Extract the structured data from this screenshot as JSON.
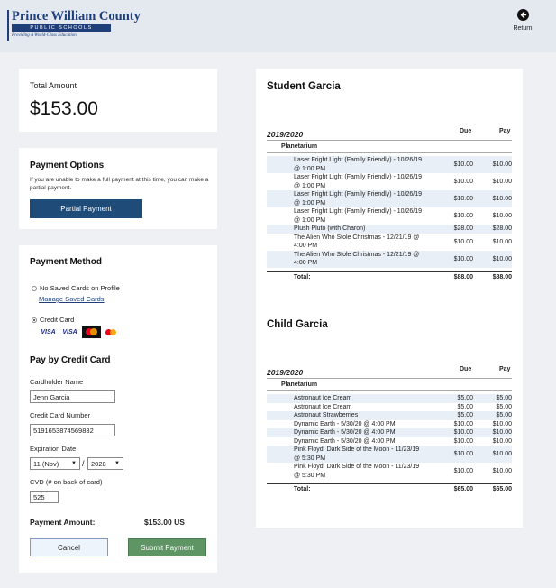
{
  "header": {
    "logo_name": "Prince William County",
    "logo_bar": "PUBLIC SCHOOLS",
    "logo_tagline": "Providing A World-Class Education",
    "return_label": "Return"
  },
  "total_amount": {
    "label": "Total Amount",
    "value": "$153.00"
  },
  "payment_options": {
    "title": "Payment Options",
    "note": "If you are unable to make a full payment at this time, you can make a partial payment.",
    "button": "Partial Payment"
  },
  "payment_method": {
    "title": "Payment Method",
    "no_saved_cards": "No Saved Cards on Profile",
    "manage_link": "Manage Saved Cards",
    "credit_card_option": "Credit Card",
    "card_brands": [
      "VISA",
      "VISA",
      "MasterCard",
      "MasterCard"
    ]
  },
  "pay_by_card": {
    "title": "Pay by Credit Card",
    "cardholder_label": "Cardholder Name",
    "cardholder_value": "Jenn Garcia",
    "card_number_label": "Credit Card Number",
    "card_number_value": "5191653874569832",
    "expiration_label": "Expiration Date",
    "exp_month": "11 (Nov)",
    "exp_year": "2028",
    "slash": "/",
    "cvd_label": "CVD (# on back of card)",
    "cvd_value": "525",
    "payment_amount_label": "Payment Amount:",
    "payment_amount_value": "$153.00   US",
    "cancel_button": "Cancel",
    "submit_button": "Submit Payment"
  },
  "students": [
    {
      "name": "Student Garcia",
      "year": "2019/2020",
      "due_header": "Due",
      "pay_header": "Pay",
      "category": "Planetarium",
      "items": [
        {
          "name": "Laser Fright Light (Family Friendly) - 10/26/19 @ 1:00 PM",
          "due": "$10.00",
          "pay": "$10.00"
        },
        {
          "name": "Laser Fright Light (Family Friendly) - 10/26/19 @ 1:00 PM",
          "due": "$10.00",
          "pay": "$10.00"
        },
        {
          "name": "Laser Fright Light (Family Friendly) - 10/26/19 @ 1:00 PM",
          "due": "$10.00",
          "pay": "$10.00"
        },
        {
          "name": "Laser Fright Light (Family Friendly) - 10/26/19 @ 1:00 PM",
          "due": "$10.00",
          "pay": "$10.00"
        },
        {
          "name": "Plush Pluto (with Charon)",
          "due": "$28.00",
          "pay": "$28.00"
        },
        {
          "name": "The Alien Who Stole Christmas - 12/21/19 @ 4:00 PM",
          "due": "$10.00",
          "pay": "$10.00"
        },
        {
          "name": "The Alien Who Stole Christmas - 12/21/19 @ 4:00 PM",
          "due": "$10.00",
          "pay": "$10.00"
        }
      ],
      "total_label": "Total:",
      "total_due": "$88.00",
      "total_pay": "$88.00"
    },
    {
      "name": "Child Garcia",
      "year": "2019/2020",
      "due_header": "Due",
      "pay_header": "Pay",
      "category": "Planetarium",
      "items": [
        {
          "name": "Astronaut Ice Cream",
          "due": "$5.00",
          "pay": "$5.00"
        },
        {
          "name": "Astronaut Ice Cream",
          "due": "$5.00",
          "pay": "$5.00"
        },
        {
          "name": "Astronaut Strawberries",
          "due": "$5.00",
          "pay": "$5.00"
        },
        {
          "name": "Dynamic Earth - 5/30/20 @ 4:00 PM",
          "due": "$10.00",
          "pay": "$10.00"
        },
        {
          "name": "Dynamic Earth - 5/30/20 @ 4:00 PM",
          "due": "$10.00",
          "pay": "$10.00"
        },
        {
          "name": "Dynamic Earth - 5/30/20 @ 4:00 PM",
          "due": "$10.00",
          "pay": "$10.00"
        },
        {
          "name": "Pink Floyd: Dark Side of the Moon - 11/23/19 @ 5:30 PM",
          "due": "$10.00",
          "pay": "$10.00"
        },
        {
          "name": "Pink Floyd: Dark Side of the Moon - 11/23/19 @ 5:30 PM",
          "due": "$10.00",
          "pay": "$10.00"
        }
      ],
      "total_label": "Total:",
      "total_due": "$65.00",
      "total_pay": "$65.00"
    }
  ]
}
